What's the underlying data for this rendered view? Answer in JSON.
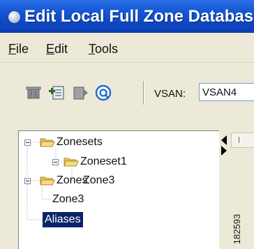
{
  "window": {
    "title": "Edit Local Full Zone Database",
    "icon": "app-globe-icon"
  },
  "menu": [
    "File",
    "Edit",
    "Tools"
  ],
  "toolbar": {
    "buttons": [
      "delete-icon",
      "add-member-icon",
      "edit-icon",
      "activate-icon"
    ],
    "vsan_label": "VSAN:",
    "vsan_value": "VSAN4"
  },
  "tree": {
    "zonesets": {
      "label": "Zonesets",
      "icon": "folder-open-icon"
    },
    "zoneset1": {
      "label": "Zoneset1",
      "icon": "folder-open-icon"
    },
    "zoneset1_zone3": {
      "label": "Zone3"
    },
    "zones": {
      "label": "Zones",
      "icon": "folder-open-icon"
    },
    "zones_zone3": {
      "label": "Zone3"
    },
    "aliases": {
      "label": "Aliases",
      "selected": true
    }
  },
  "figure_code": "182593",
  "colors": {
    "titlebar": "#1558d6",
    "selection": "#0a246a",
    "folder": "#f3d679"
  }
}
